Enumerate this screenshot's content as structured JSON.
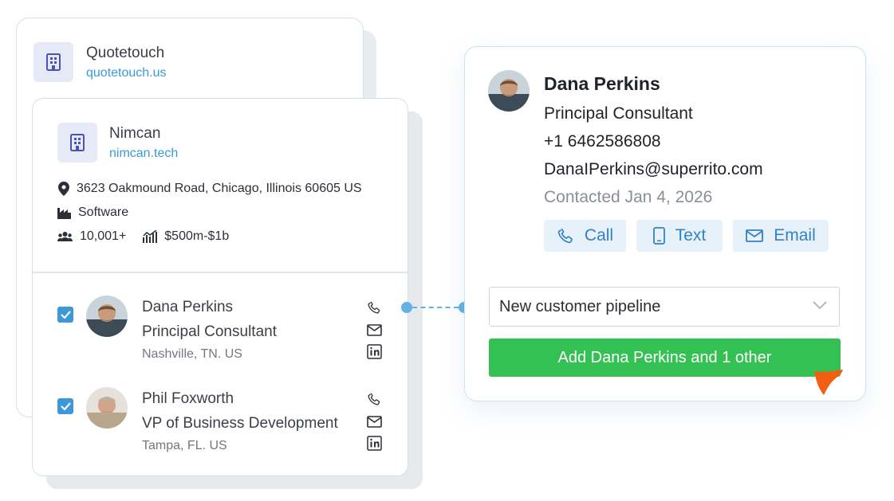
{
  "company_back": {
    "name": "Quotetouch",
    "domain": "quotetouch.us"
  },
  "company_front": {
    "name": "Nimcan",
    "domain": "nimcan.tech",
    "address": "3623 Oakmound Road, Chicago, Illinois 60605 US",
    "industry": "Software",
    "employees": "10,001+",
    "revenue": "$500m-$1b"
  },
  "contacts": [
    {
      "name": "Dana Perkins",
      "title": "Principal Consultant",
      "location": "Nashville, TN. US",
      "checked": true
    },
    {
      "name": "Phil Foxworth",
      "title": "VP of Business Development",
      "location": "Tampa, FL. US",
      "checked": true
    }
  ],
  "detail": {
    "name": "Dana Perkins",
    "title": "Principal Consultant",
    "phone": "+1 6462586808",
    "email": "DanaIPerkins@superrito.com",
    "contacted": "Contacted Jan 4, 2026",
    "actions": {
      "call": "Call",
      "text": "Text",
      "email": "Email"
    },
    "pipeline": {
      "selected": "New customer pipeline"
    },
    "add_button": "Add Dana Perkins and 1 other"
  },
  "colors": {
    "accent_blue": "#3d98d8",
    "link_blue": "#3a9ad9",
    "add_green": "#34c154",
    "cursor_orange": "#f35f12"
  }
}
